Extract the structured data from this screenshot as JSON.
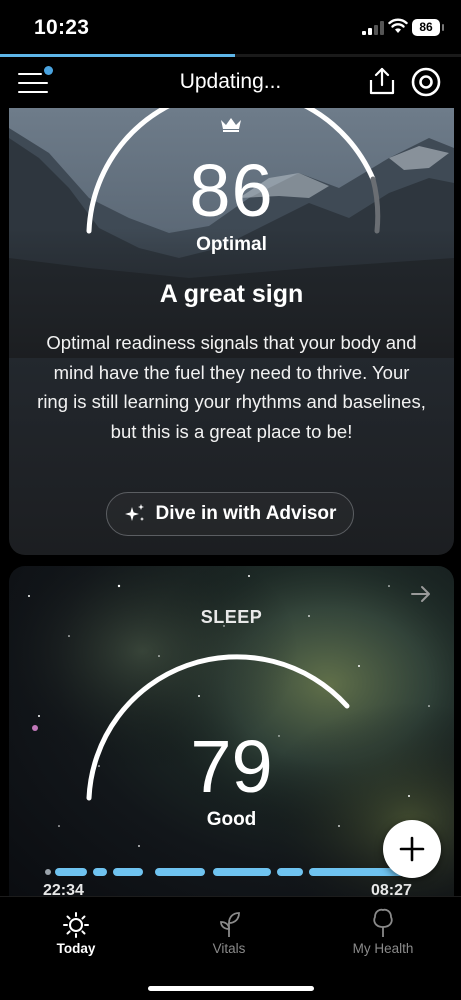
{
  "status_bar": {
    "time": "10:23",
    "battery": "86"
  },
  "progress": {
    "fraction": 0.51,
    "color": "#5eb6e8"
  },
  "nav": {
    "title": "Updating..."
  },
  "readiness": {
    "score": "86",
    "label": "Optimal",
    "headline": "A great sign",
    "description": "Optimal readiness signals that your body and mind have the fuel they need to thrive. Your ring is still learning your rhythms and baselines, but this is a great place to be!",
    "advisor_button": "Dive in with Advisor"
  },
  "sleep": {
    "label": "SLEEP",
    "score": "79",
    "quality": "Good",
    "start_time": "22:34",
    "end_time": "08:27",
    "timeline_color": "#6fc3f0"
  },
  "tabs": [
    {
      "label": "Today",
      "icon": "sun-icon",
      "active": true
    },
    {
      "label": "Vitals",
      "icon": "sprout-icon",
      "active": false
    },
    {
      "label": "My Health",
      "icon": "tree-icon",
      "active": false
    }
  ],
  "colors": {
    "accent": "#4aa3df",
    "inactive_tab": "#8a8a8a"
  }
}
